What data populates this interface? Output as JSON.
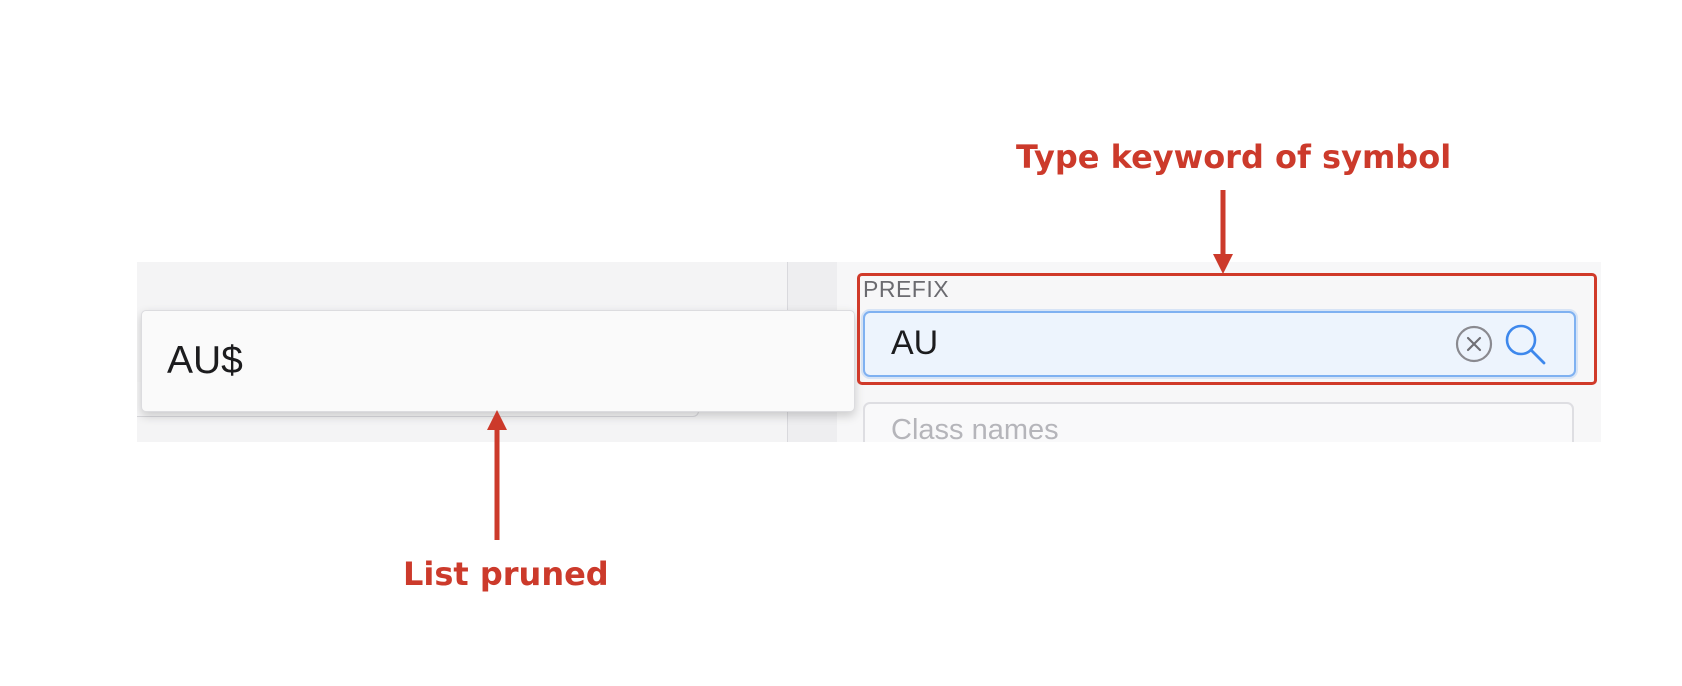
{
  "annotations": {
    "top": "Type keyword of symbol",
    "bottom": "List pruned"
  },
  "dropdown": {
    "items": [
      {
        "label": "AU$"
      }
    ]
  },
  "prefix": {
    "label": "PREFIX",
    "value": "AU"
  },
  "class_names": {
    "placeholder": "Class names"
  },
  "colors": {
    "annotation": "#cc3a2b",
    "input_focus_border": "#7fb1f1",
    "input_focus_bg": "#edf4fd",
    "search_icon": "#3e88ec"
  },
  "icons": {
    "clear": "circle-x-icon",
    "search": "magnifier-icon"
  }
}
